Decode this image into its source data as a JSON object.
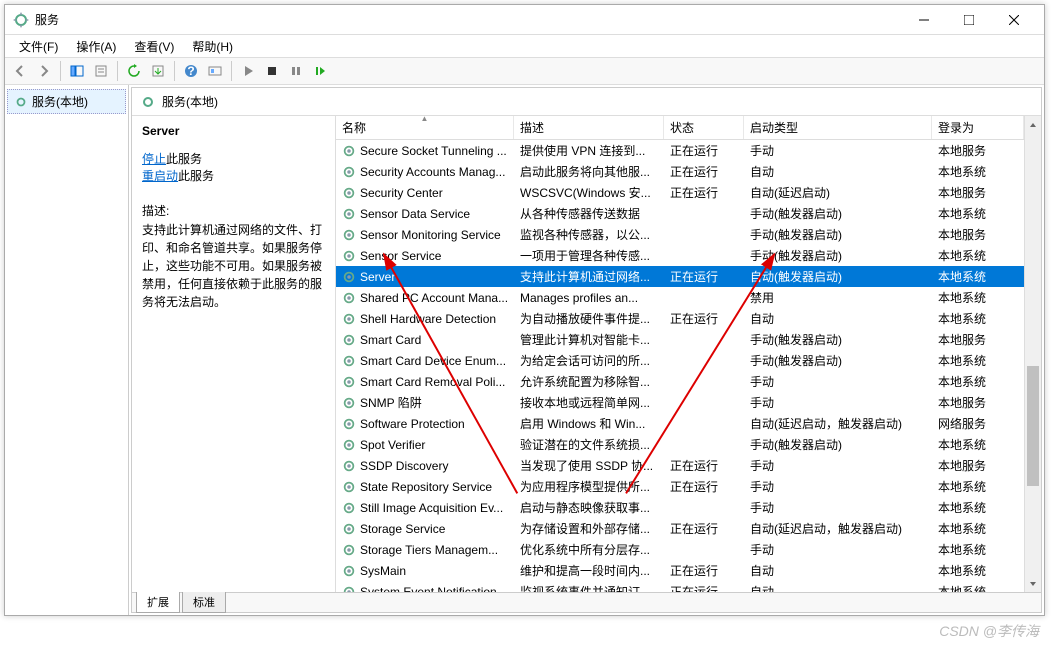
{
  "window": {
    "title": "服务"
  },
  "menu": {
    "file": "文件(F)",
    "action": "操作(A)",
    "view": "查看(V)",
    "help": "帮助(H)"
  },
  "tree": {
    "root": "服务(本地)"
  },
  "main_header": "服务(本地)",
  "detail": {
    "name": "Server",
    "stop_link": "停止",
    "stop_suffix": "此服务",
    "restart_link": "重启动",
    "restart_suffix": "此服务",
    "desc_label": "描述:",
    "desc_text": "支持此计算机通过网络的文件、打印、和命名管道共享。如果服务停止，这些功能不可用。如果服务被禁用，任何直接依赖于此服务的服务将无法启动。"
  },
  "columns": {
    "name": "名称",
    "desc": "描述",
    "status": "状态",
    "type": "启动类型",
    "logon": "登录为"
  },
  "tabs": {
    "extended": "扩展",
    "standard": "标准"
  },
  "watermark": "CSDN @李传海",
  "selected_index": 6,
  "rows": [
    {
      "name": "Secure Socket Tunneling ...",
      "desc": "提供使用 VPN 连接到...",
      "status": "正在运行",
      "type": "手动",
      "logon": "本地服务"
    },
    {
      "name": "Security Accounts Manag...",
      "desc": "启动此服务将向其他服...",
      "status": "正在运行",
      "type": "自动",
      "logon": "本地系统"
    },
    {
      "name": "Security Center",
      "desc": "WSCSVC(Windows 安...",
      "status": "正在运行",
      "type": "自动(延迟启动)",
      "logon": "本地服务"
    },
    {
      "name": "Sensor Data Service",
      "desc": "从各种传感器传送数据",
      "status": "",
      "type": "手动(触发器启动)",
      "logon": "本地系统"
    },
    {
      "name": "Sensor Monitoring Service",
      "desc": "监视各种传感器，以公...",
      "status": "",
      "type": "手动(触发器启动)",
      "logon": "本地服务"
    },
    {
      "name": "Sensor Service",
      "desc": "一项用于管理各种传感...",
      "status": "",
      "type": "手动(触发器启动)",
      "logon": "本地系统"
    },
    {
      "name": "Server",
      "desc": "支持此计算机通过网络...",
      "status": "正在运行",
      "type": "自动(触发器启动)",
      "logon": "本地系统"
    },
    {
      "name": "Shared PC Account Mana...",
      "desc": "Manages profiles an...",
      "status": "",
      "type": "禁用",
      "logon": "本地系统"
    },
    {
      "name": "Shell Hardware Detection",
      "desc": "为自动播放硬件事件提...",
      "status": "正在运行",
      "type": "自动",
      "logon": "本地系统"
    },
    {
      "name": "Smart Card",
      "desc": "管理此计算机对智能卡...",
      "status": "",
      "type": "手动(触发器启动)",
      "logon": "本地服务"
    },
    {
      "name": "Smart Card Device Enum...",
      "desc": "为给定会话可访问的所...",
      "status": "",
      "type": "手动(触发器启动)",
      "logon": "本地系统"
    },
    {
      "name": "Smart Card Removal Poli...",
      "desc": "允许系统配置为移除智...",
      "status": "",
      "type": "手动",
      "logon": "本地系统"
    },
    {
      "name": "SNMP 陷阱",
      "desc": "接收本地或远程简单网...",
      "status": "",
      "type": "手动",
      "logon": "本地服务"
    },
    {
      "name": "Software Protection",
      "desc": "启用 Windows 和 Win...",
      "status": "",
      "type": "自动(延迟启动，触发器启动)",
      "logon": "网络服务"
    },
    {
      "name": "Spot Verifier",
      "desc": "验证潜在的文件系统损...",
      "status": "",
      "type": "手动(触发器启动)",
      "logon": "本地系统"
    },
    {
      "name": "SSDP Discovery",
      "desc": "当发现了使用 SSDP 协...",
      "status": "正在运行",
      "type": "手动",
      "logon": "本地服务"
    },
    {
      "name": "State Repository Service",
      "desc": "为应用程序模型提供所...",
      "status": "正在运行",
      "type": "手动",
      "logon": "本地系统"
    },
    {
      "name": "Still Image Acquisition Ev...",
      "desc": "启动与静态映像获取事...",
      "status": "",
      "type": "手动",
      "logon": "本地系统"
    },
    {
      "name": "Storage Service",
      "desc": "为存储设置和外部存储...",
      "status": "正在运行",
      "type": "自动(延迟启动，触发器启动)",
      "logon": "本地系统"
    },
    {
      "name": "Storage Tiers Managem...",
      "desc": "优化系统中所有分层存...",
      "status": "",
      "type": "手动",
      "logon": "本地系统"
    },
    {
      "name": "SysMain",
      "desc": "维护和提高一段时间内...",
      "status": "正在运行",
      "type": "自动",
      "logon": "本地系统"
    },
    {
      "name": "System Event Notification...",
      "desc": "监视系统事件并通知订...",
      "status": "正在运行",
      "type": "自动",
      "logon": "本地系统"
    }
  ]
}
